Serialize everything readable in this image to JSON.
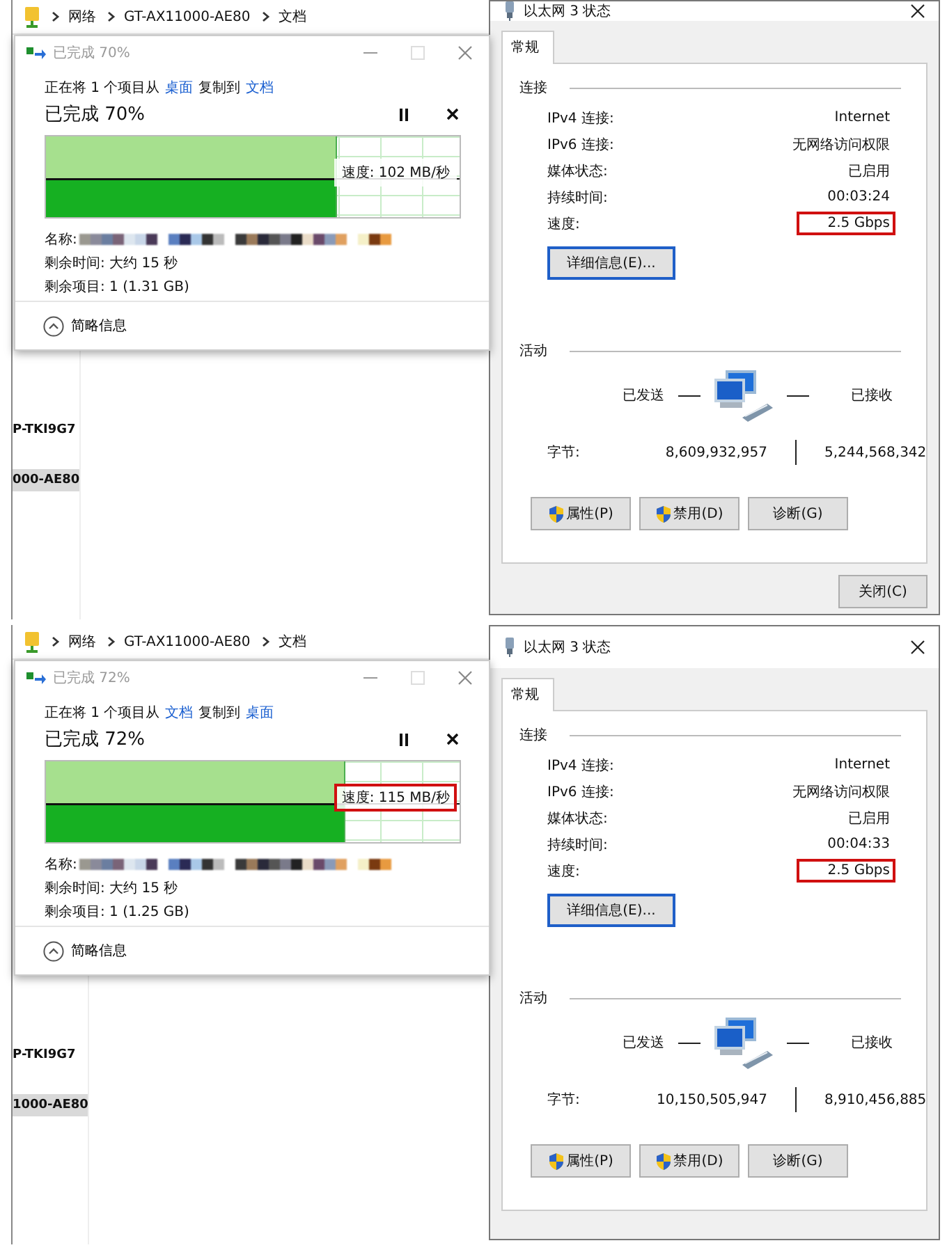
{
  "panels": [
    {
      "explorer": {
        "breadcrumb": [
          "网络",
          "GT-AX11000-AE80",
          "文档"
        ],
        "sidebar_items": [
          {
            "label": "P-TKI9G7",
            "selected": false
          },
          {
            "label": "000-AE80",
            "selected": true
          }
        ]
      },
      "copy_dialog": {
        "title": "已完成 70%",
        "description": {
          "prefix": "正在将 1 个项目从",
          "source": "桌面",
          "middle": "复制到",
          "destination": "文档"
        },
        "heading": "已完成 70%",
        "level": 0.7,
        "speed": "速度: 102 MB/秒",
        "speed_highlighted": false,
        "name_label": "名称:",
        "details": [
          "剩余时间: 大约 15 秒",
          "剩余项目: 1 (1.31 GB)"
        ],
        "toggle": "简略信息"
      },
      "status_dialog": {
        "title": "以太网 3 状态",
        "tabs": [
          {
            "label": "常规",
            "selected": true
          }
        ],
        "connection_heading": "连接",
        "rows": [
          {
            "label": "IPv4 连接:",
            "value": "Internet",
            "highlighted": false
          },
          {
            "label": "IPv6 连接:",
            "value": "无网络访问权限",
            "highlighted": false
          },
          {
            "label": "媒体状态:",
            "value": "已启用",
            "highlighted": false
          },
          {
            "label": "持续时间:",
            "value": "00:03:24",
            "highlighted": false
          },
          {
            "label": "速度:",
            "value": "2.5 Gbps",
            "highlighted": true
          }
        ],
        "details_button": "详细信息(E)...",
        "activity_heading": "活动",
        "sent_label": "已发送",
        "received_label": "已接收",
        "bytes_label": "字节:",
        "bytes_sent": "8,609,932,957",
        "bytes_received": "5,244,568,342",
        "buttons": [
          {
            "label": "属性(P)",
            "kind": "shield"
          },
          {
            "label": "禁用(D)",
            "kind": "shield"
          },
          {
            "label": "诊断(G)",
            "kind": "plain"
          }
        ],
        "close_button": "关闭(C)"
      }
    },
    {
      "explorer": {
        "breadcrumb": [
          "网络",
          "GT-AX11000-AE80",
          "文档"
        ],
        "sidebar_items": [
          {
            "label": "P-TKI9G7",
            "selected": false
          },
          {
            "label": "1000-AE80",
            "selected": true
          }
        ]
      },
      "copy_dialog": {
        "title": "已完成 72%",
        "description": {
          "prefix": "正在将 1 个项目从",
          "source": "文档",
          "middle": "复制到",
          "destination": "桌面"
        },
        "heading": "已完成 72%",
        "level": 0.72,
        "speed": "速度: 115 MB/秒",
        "speed_highlighted": true,
        "name_label": "名称:",
        "details": [
          "剩余时间: 大约 15 秒",
          "剩余项目: 1 (1.25 GB)"
        ],
        "toggle": "简略信息"
      },
      "status_dialog": {
        "title": "以太网 3 状态",
        "tabs": [
          {
            "label": "常规",
            "selected": true
          }
        ],
        "connection_heading": "连接",
        "rows": [
          {
            "label": "IPv4 连接:",
            "value": "Internet",
            "highlighted": false
          },
          {
            "label": "IPv6 连接:",
            "value": "无网络访问权限",
            "highlighted": false
          },
          {
            "label": "媒体状态:",
            "value": "已启用",
            "highlighted": false
          },
          {
            "label": "持续时间:",
            "value": "00:04:33",
            "highlighted": false
          },
          {
            "label": "速度:",
            "value": "2.5 Gbps",
            "highlighted": true
          }
        ],
        "details_button": "详细信息(E)...",
        "activity_heading": "活动",
        "sent_label": "已发送",
        "received_label": "已接收",
        "bytes_label": "字节:",
        "bytes_sent": "10,150,505,947",
        "bytes_received": "8,910,456,885",
        "buttons": [
          {
            "label": "属性(P)",
            "kind": "shield"
          },
          {
            "label": "禁用(D)",
            "kind": "shield"
          },
          {
            "label": "诊断(G)",
            "kind": "plain"
          }
        ]
      }
    }
  ]
}
